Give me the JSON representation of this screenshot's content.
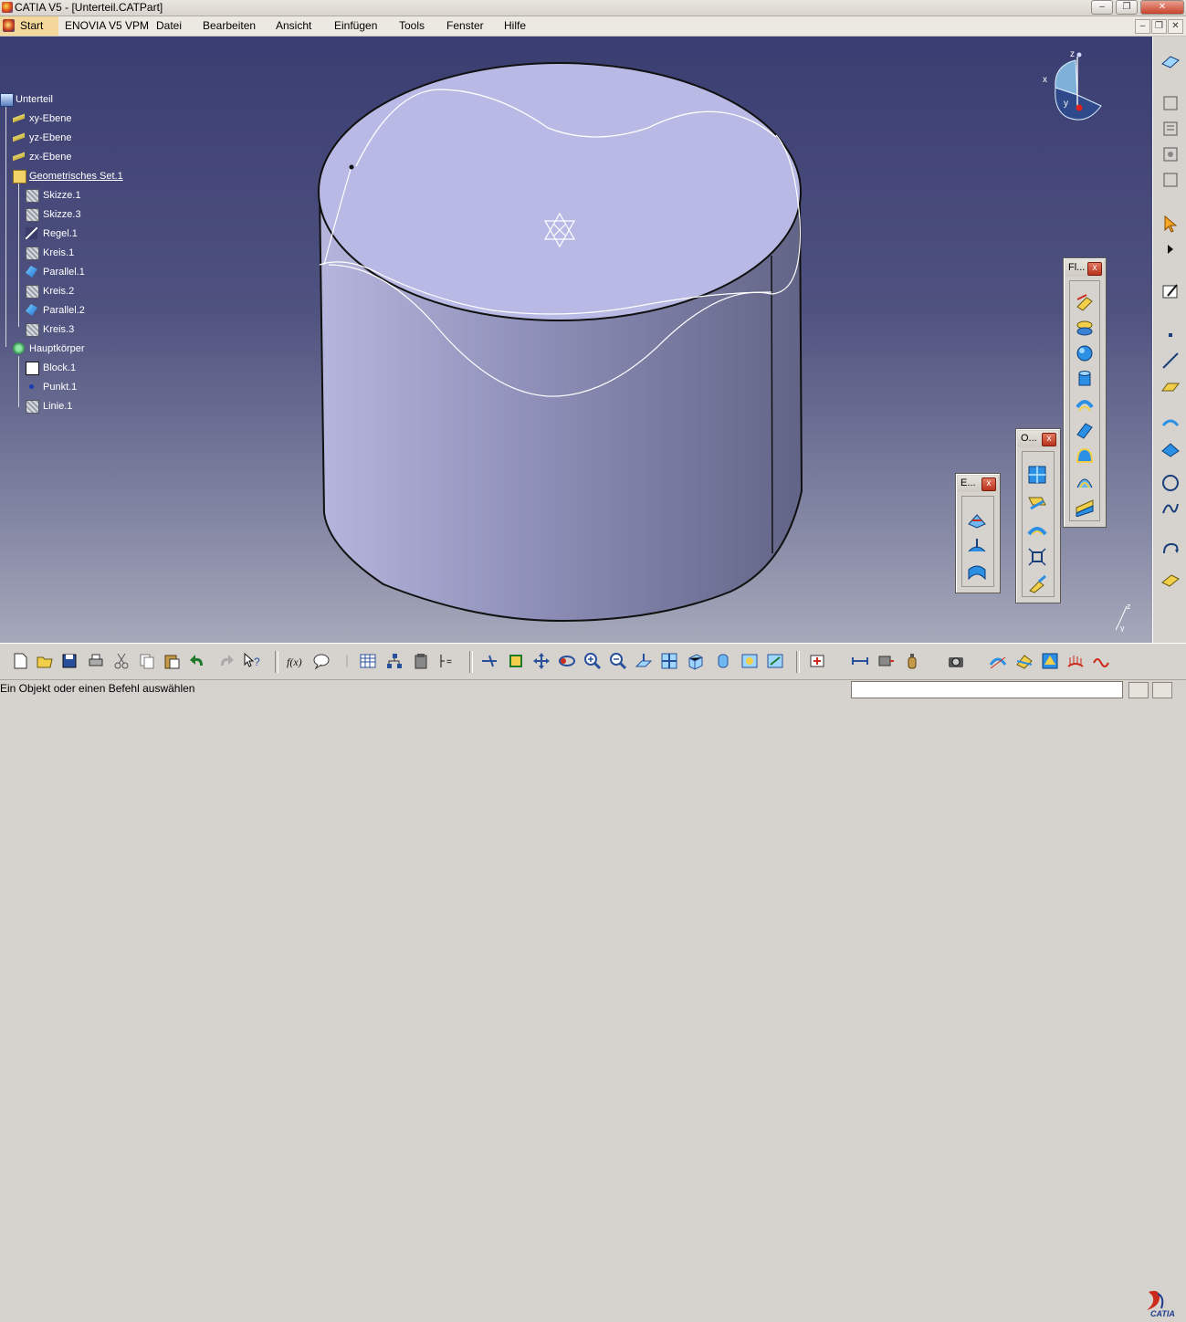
{
  "window": {
    "title": "CATIA V5 - [Unterteil.CATPart]",
    "minimize": "–",
    "restore": "❐",
    "close": "✕"
  },
  "mdi": {
    "minimize": "–",
    "restore": "❐",
    "close": "✕"
  },
  "menu": {
    "start": "Start",
    "items": [
      "ENOVIA V5 VPM",
      "Datei",
      "Bearbeiten",
      "Ansicht",
      "Einfügen",
      "Tools",
      "Fenster",
      "Hilfe"
    ]
  },
  "tree": {
    "root": "Unterteil",
    "items": [
      {
        "label": "xy-Ebene",
        "icon": "plane-icon"
      },
      {
        "label": "yz-Ebene",
        "icon": "plane-icon"
      },
      {
        "label": "zx-Ebene",
        "icon": "plane-icon"
      },
      {
        "label": "Geometrisches Set.1",
        "icon": "geometrical-set-icon"
      },
      {
        "label": "Skizze.1",
        "icon": "sketch-icon"
      },
      {
        "label": "Skizze.3",
        "icon": "sketch-icon"
      },
      {
        "label": "Regel.1",
        "icon": "law-icon"
      },
      {
        "label": "Kreis.1",
        "icon": "circle-icon"
      },
      {
        "label": "Parallel.1",
        "icon": "parallel-curve-icon"
      },
      {
        "label": "Kreis.2",
        "icon": "circle-icon"
      },
      {
        "label": "Parallel.2",
        "icon": "parallel-curve-icon"
      },
      {
        "label": "Kreis.3",
        "icon": "circle-icon"
      },
      {
        "label": "Hauptkörper",
        "icon": "part-body-icon"
      },
      {
        "label": "Block.1",
        "icon": "pad-icon"
      },
      {
        "label": "Punkt.1",
        "icon": "point-icon"
      },
      {
        "label": "Linie.1",
        "icon": "line-icon"
      }
    ]
  },
  "compass": {
    "x": "x",
    "y": "y",
    "z": "z"
  },
  "triad": {
    "y": "y",
    "z": "z"
  },
  "palettes": {
    "flaechen": {
      "title": "Fl...",
      "close": "x"
    },
    "operationen": {
      "title": "O...",
      "close": "x"
    },
    "extrude": {
      "title": "E...",
      "close": "x"
    }
  },
  "status": {
    "text": "Ein Objekt oder einen Befehl auswählen",
    "input_value": ""
  },
  "logo": {
    "text": "CATIA"
  },
  "colors": {
    "viewport_top": "#3a3d71",
    "viewport_bottom": "#a6a8ba",
    "part_face": "#b9b9e6",
    "part_side": "#8d8db4",
    "menu_start": "#f4d79b",
    "close_red": "#c8432a"
  }
}
